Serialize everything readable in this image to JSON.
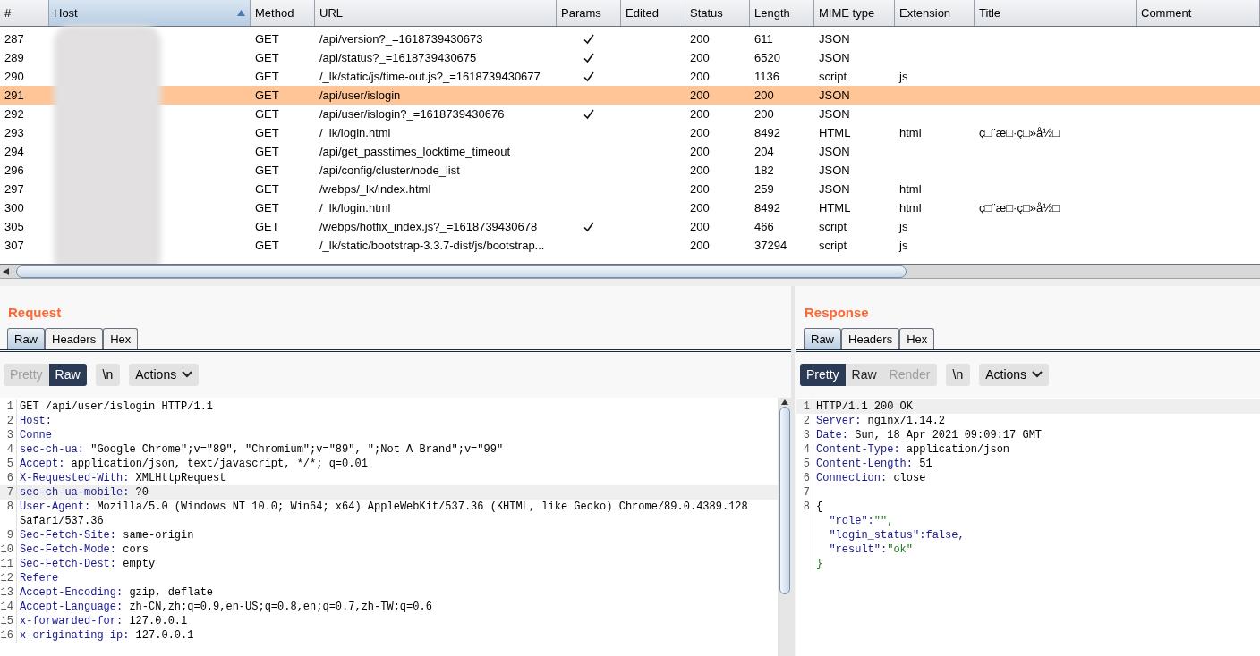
{
  "table": {
    "columns": [
      {
        "label": "#"
      },
      {
        "label": "Host",
        "sorted": true
      },
      {
        "label": "Method"
      },
      {
        "label": "URL"
      },
      {
        "label": "Params"
      },
      {
        "label": "Edited"
      },
      {
        "label": "Status"
      },
      {
        "label": "Length"
      },
      {
        "label": "MIME type"
      },
      {
        "label": "Extension"
      },
      {
        "label": "Title"
      },
      {
        "label": "Comment"
      }
    ],
    "rows": [
      {
        "num": "287",
        "method": "GET",
        "url": "/api/version?_=1618739430673",
        "params": true,
        "status": "200",
        "length": "611",
        "mime": "JSON",
        "selected": false
      },
      {
        "num": "289",
        "method": "GET",
        "url": "/api/status?_=1618739430675",
        "params": true,
        "status": "200",
        "length": "6520",
        "mime": "JSON",
        "selected": false
      },
      {
        "num": "290",
        "method": "GET",
        "url": "/_lk/static/js/time-out.js?_=1618739430677",
        "params": true,
        "status": "200",
        "length": "1136",
        "mime": "script",
        "extension": "js",
        "selected": false
      },
      {
        "num": "291",
        "method": "GET",
        "url": "/api/user/islogin",
        "params": false,
        "status": "200",
        "length": "200",
        "mime": "JSON",
        "selected": true
      },
      {
        "num": "292",
        "method": "GET",
        "url": "/api/user/islogin?_=1618739430676",
        "params": true,
        "status": "200",
        "length": "200",
        "mime": "JSON",
        "selected": false
      },
      {
        "num": "293",
        "method": "GET",
        "url": "/_lk/login.html",
        "params": false,
        "status": "200",
        "length": "8492",
        "mime": "HTML",
        "extension": "html",
        "title": "ç□¨æ□·ç□»å½□",
        "selected": false
      },
      {
        "num": "294",
        "method": "GET",
        "url": "/api/get_passtimes_locktime_timeout",
        "params": false,
        "status": "200",
        "length": "204",
        "mime": "JSON",
        "selected": false
      },
      {
        "num": "296",
        "method": "GET",
        "url": "/api/config/cluster/node_list",
        "params": false,
        "status": "200",
        "length": "182",
        "mime": "JSON",
        "selected": false
      },
      {
        "num": "297",
        "method": "GET",
        "url": "/webps/_lk/index.html",
        "params": false,
        "status": "200",
        "length": "259",
        "mime": "JSON",
        "extension": "html",
        "selected": false
      },
      {
        "num": "300",
        "method": "GET",
        "url": "/_lk/login.html",
        "params": false,
        "status": "200",
        "length": "8492",
        "mime": "HTML",
        "extension": "html",
        "title": "ç□¨æ□·ç□»å½□",
        "selected": false
      },
      {
        "num": "305",
        "method": "GET",
        "url": "/webps/hotfix_index.js?_=1618739430678",
        "params": true,
        "status": "200",
        "length": "466",
        "mime": "script",
        "extension": "js",
        "selected": false
      },
      {
        "num": "307",
        "method": "GET",
        "url": "/_lk/static/bootstrap-3.3.7-dist/js/bootstrap...",
        "params": false,
        "status": "200",
        "length": "37294",
        "mime": "script",
        "extension": "js",
        "selected": false
      }
    ]
  },
  "panes": [
    {
      "title": "Request",
      "tabs": [
        {
          "label": "Raw",
          "selected": true
        },
        {
          "label": "Headers",
          "selected": false
        },
        {
          "label": "Hex",
          "selected": false
        }
      ],
      "views": [
        {
          "label": "Pretty",
          "selected": false,
          "disabled": true
        },
        {
          "label": "Raw",
          "selected": true,
          "disabled": false
        }
      ],
      "newline_button": "\\n",
      "actions_button": "Actions",
      "scrollbar": true,
      "lines": [
        {
          "num": "1",
          "value": "GET /api/user/islogin HTTP/1.1",
          "current": false
        },
        {
          "num": "2",
          "key": "Host:",
          "current": false
        },
        {
          "num": "3",
          "key": "Conne",
          "current": false
        },
        {
          "num": "4",
          "key": "sec-ch-ua:",
          "value": "\"Google Chrome\";v=\"89\", \"Chromium\";v=\"89\", \";Not A Brand\";v=\"99\"",
          "current": false
        },
        {
          "num": "5",
          "key": "Accept:",
          "value": "application/json, text/javascript, */*; q=0.01",
          "current": false
        },
        {
          "num": "6",
          "key": "X-Requested-With:",
          "value": "XMLHttpRequest",
          "current": false
        },
        {
          "num": "7",
          "key": "sec-ch-ua-mobile:",
          "value": "?0",
          "current": true
        },
        {
          "num": "8",
          "key": "User-Agent:",
          "value": "Mozilla/5.0 (Windows NT 10.0; Win64; x64) AppleWebKit/537.36 (KHTML, like Gecko) Chrome/89.0.4389.128 Safari/537.36",
          "current": false
        },
        {
          "num": "9",
          "key": "Sec-Fetch-Site:",
          "value": "same-origin",
          "current": false
        },
        {
          "num": "10",
          "key": "Sec-Fetch-Mode:",
          "value": "cors",
          "current": false
        },
        {
          "num": "11",
          "key": "Sec-Fetch-Dest:",
          "value": "empty",
          "current": false
        },
        {
          "num": "12",
          "key": "Refere",
          "current": false
        },
        {
          "num": "13",
          "key": "Accept-Encoding:",
          "value": "gzip, deflate",
          "current": false
        },
        {
          "num": "14",
          "key": "Accept-Language:",
          "value": "zh-CN,zh;q=0.9,en-US;q=0.8,en;q=0.7,zh-TW;q=0.6",
          "current": false
        },
        {
          "num": "15",
          "key": "x-forwarded-for:",
          "value": "127.0.0.1",
          "current": false
        },
        {
          "num": "16",
          "key": "x-originating-ip:",
          "value": "127.0.0.1",
          "current": false
        }
      ]
    },
    {
      "title": "Response",
      "tabs": [
        {
          "label": "Raw",
          "selected": true
        },
        {
          "label": "Headers",
          "selected": false
        },
        {
          "label": "Hex",
          "selected": false
        }
      ],
      "views": [
        {
          "label": "Pretty",
          "selected": true,
          "disabled": false
        },
        {
          "label": "Raw",
          "selected": false,
          "disabled": false
        },
        {
          "label": "Render",
          "selected": false,
          "disabled": true
        }
      ],
      "newline_button": "\\n",
      "actions_button": "Actions",
      "scrollbar": false,
      "lines": [
        {
          "num": "1",
          "value": "HTTP/1.1 200 OK",
          "current": true
        },
        {
          "num": "2",
          "key": "Server:",
          "value": "nginx/1.14.2",
          "current": false
        },
        {
          "num": "3",
          "key": "Date:",
          "value": "Sun, 18 Apr 2021 09:09:17 GMT",
          "current": false
        },
        {
          "num": "4",
          "key": "Content-Type:",
          "value": "application/json",
          "current": false
        },
        {
          "num": "5",
          "key": "Content-Length:",
          "value": "51",
          "current": false
        },
        {
          "num": "6",
          "key": "Connection:",
          "value": "close",
          "current": false
        },
        {
          "num": "7",
          "current": false
        },
        {
          "num": "8",
          "value": "{",
          "current": false
        },
        {
          "key": "  \"role\":",
          "value": "\"\",",
          "current": false
        },
        {
          "key": "  \"login_status\":false,",
          "current": false
        },
        {
          "key": "  \"result\":",
          "value": "\"ok\"",
          "current": false
        },
        {
          "value": "}",
          "current": false
        }
      ]
    }
  ]
}
